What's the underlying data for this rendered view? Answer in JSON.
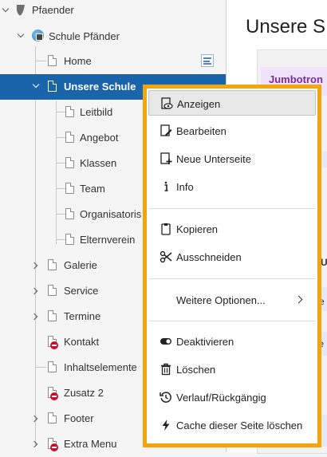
{
  "tree": {
    "root_label": "Pfaender",
    "site_label": "Schule Pfänder",
    "items": [
      {
        "label": "Home"
      },
      {
        "label": "Unsere Schule"
      },
      {
        "label": "Leitbild"
      },
      {
        "label": "Angebot"
      },
      {
        "label": "Klassen"
      },
      {
        "label": "Team"
      },
      {
        "label": "Organisatoris"
      },
      {
        "label": "Elternverein"
      },
      {
        "label": "Galerie"
      },
      {
        "label": "Service"
      },
      {
        "label": "Termine"
      },
      {
        "label": "Kontakt"
      },
      {
        "label": "Inhaltselemente"
      },
      {
        "label": "Zusatz 2"
      },
      {
        "label": "Footer"
      },
      {
        "label": "Extra Menu"
      }
    ]
  },
  "main": {
    "title": "Unsere S",
    "jumbotron_label": "Jumbotron",
    "snippets": [
      "U",
      "re",
      "te"
    ]
  },
  "context_menu": {
    "items": [
      {
        "label": "Anzeigen",
        "icon": "eye-icon"
      },
      {
        "label": "Bearbeiten",
        "icon": "edit-icon"
      },
      {
        "label": "Neue Unterseite",
        "icon": "new-page-icon"
      },
      {
        "label": "Info",
        "icon": "info-icon"
      },
      {
        "label": "Kopieren",
        "icon": "clipboard-icon"
      },
      {
        "label": "Ausschneiden",
        "icon": "scissors-icon"
      },
      {
        "label": "Weitere Optionen...",
        "icon": "chevron-right-icon"
      },
      {
        "label": "Deaktivieren",
        "icon": "toggle-icon"
      },
      {
        "label": "Löschen",
        "icon": "trash-icon"
      },
      {
        "label": "Verlauf/Rückgängig",
        "icon": "history-icon"
      },
      {
        "label": "Cache dieser Seite löschen",
        "icon": "bolt-icon"
      }
    ]
  },
  "colors": {
    "selection": "#1a64ab",
    "highlight_outline": "#f5a40a",
    "hidden_badge": "#c8102e",
    "jumbotron_text": "#7a2ca0"
  }
}
